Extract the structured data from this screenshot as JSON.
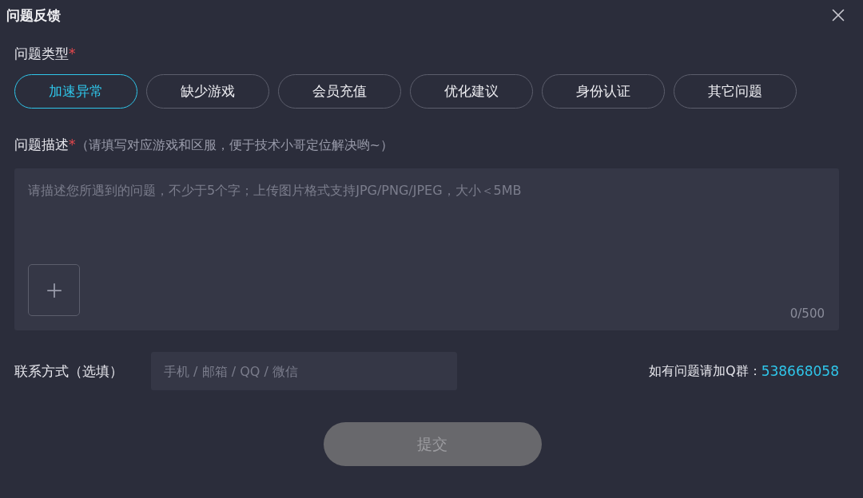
{
  "window": {
    "title": "问题反馈"
  },
  "problem_type": {
    "label": "问题类型",
    "required_mark": "*",
    "options": [
      {
        "label": "加速异常",
        "selected": true
      },
      {
        "label": "缺少游戏",
        "selected": false
      },
      {
        "label": "会员充值",
        "selected": false
      },
      {
        "label": "优化建议",
        "selected": false
      },
      {
        "label": "身份认证",
        "selected": false
      },
      {
        "label": "其它问题",
        "selected": false
      }
    ]
  },
  "description": {
    "label": "问题描述",
    "required_mark": "*",
    "hint": "（请填写对应游戏和区服，便于技术小哥定位解决哟~）",
    "placeholder": "请描述您所遇到的问题，不少于5个字；上传图片格式支持JPG/PNG/JPEG，大小＜5MB",
    "counter": "0/500"
  },
  "contact": {
    "label": "联系方式（选填）",
    "placeholder": "手机 / 邮箱 / QQ / 微信"
  },
  "group_note": {
    "text": "如有问题请加Q群：",
    "number": "538668058"
  },
  "submit": {
    "label": "提交",
    "disabled": true
  }
}
